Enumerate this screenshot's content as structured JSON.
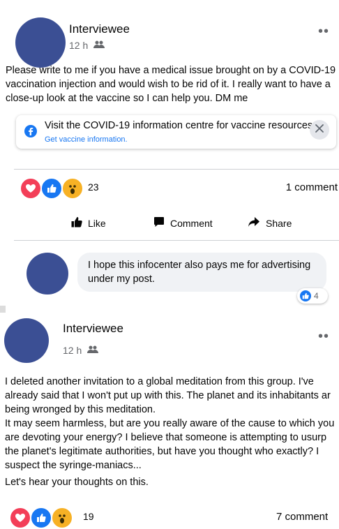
{
  "post1": {
    "author": "Interviewee",
    "time": "12 h",
    "more": "••",
    "text": "Please write to me if you have a medical issue brought on by a COVID-19 vaccination injection and would wish to be rid of it. I really want to have a close-up look at the vaccine so I can help you. DM me",
    "info_title": "Visit the COVID-19 information centre for vaccine resources.",
    "info_link": "Get vaccine information.",
    "reaction_count": "23",
    "comments": "1 comment",
    "actions": {
      "like": "Like",
      "comment": "Comment",
      "share": "Share"
    },
    "comment_text": "I hope this infocenter also pays me for advertising under my post.",
    "comment_likes": "4"
  },
  "post2": {
    "author": "Interviewee",
    "time": "12 h",
    "more": "••",
    "text_1": "I deleted another invitation to a global meditation from this group. I've already said that I won't put up with this. The planet and its inhabitants ar being wronged by this meditation.",
    "text_2": "It may seem harmless, but are you really aware of the cause to which you are devoting your energy? I believe that someone is attempting to usurp the planet's legitimate authorities, but have you thought who exactly? I suspect the syringe-maniacs...",
    "text_3": "Let's hear your thoughts on this.",
    "reaction_count": "19",
    "comments": "7 comment"
  },
  "colors": {
    "brand_blue": "#1877f2",
    "love_red": "#f33e58",
    "wow_yellow": "#f7b125",
    "avatar": "#3b4f94"
  },
  "icons": [
    "facebook-icon",
    "close-icon",
    "friends-icon",
    "love-reaction-icon",
    "like-reaction-icon",
    "wow-reaction-icon",
    "thumbs-up-icon",
    "comment-icon",
    "share-icon"
  ]
}
